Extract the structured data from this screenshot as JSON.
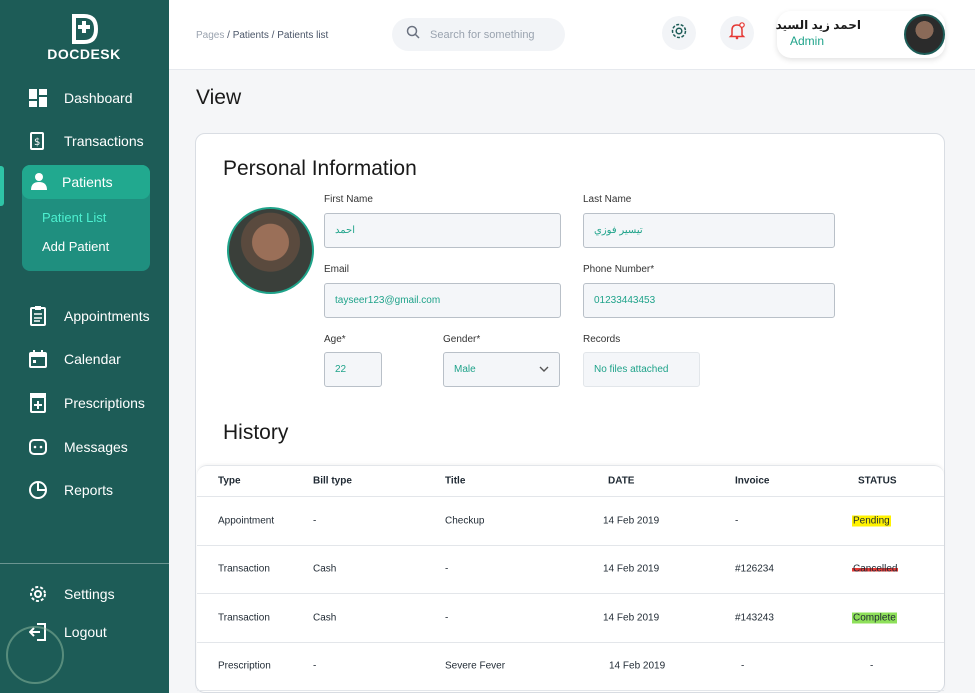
{
  "brand": {
    "name": "DOCDESK"
  },
  "sidebar": {
    "items": [
      {
        "label": "Dashboard",
        "icon": "dashboard-icon"
      },
      {
        "label": "Transactions",
        "icon": "transactions-icon"
      },
      {
        "label": "Patients",
        "icon": "user-icon",
        "active": true
      },
      {
        "label": "Appointments",
        "icon": "clipboard-icon"
      },
      {
        "label": "Calendar",
        "icon": "calendar-icon"
      },
      {
        "label": "Prescriptions",
        "icon": "prescription-icon"
      },
      {
        "label": "Messages",
        "icon": "chat-icon"
      },
      {
        "label": "Reports",
        "icon": "pie-chart-icon"
      }
    ],
    "sub_items": [
      {
        "label": "Patient List",
        "active": true
      },
      {
        "label": "Add Patient"
      }
    ],
    "bottom": [
      {
        "label": "Settings",
        "icon": "gear-icon"
      },
      {
        "label": "Logout",
        "icon": "logout-icon"
      }
    ]
  },
  "header": {
    "breadcrumb": {
      "root": "Pages",
      "sep": "/",
      "section": "Patients",
      "current": "Patients list"
    },
    "search_placeholder": "Search for something",
    "user": {
      "name": "احمد زيد السيد",
      "role": "Admin"
    }
  },
  "page": {
    "title": "View"
  },
  "personal": {
    "title": "Personal Information",
    "first_name": {
      "label": "First Name",
      "value": "احمد"
    },
    "last_name": {
      "label": "Last Name",
      "value": "تيسير فوزي"
    },
    "email": {
      "label": "Email",
      "value": "tayseer123@gmail.com"
    },
    "phone": {
      "label": "Phone Number*",
      "value": "01233443453"
    },
    "age": {
      "label": "Age*",
      "value": "22"
    },
    "gender": {
      "label": "Gender*",
      "value": "Male"
    },
    "records": {
      "label": "Records",
      "value": "No files attached"
    }
  },
  "history": {
    "title": "History",
    "columns": [
      "Type",
      "Bill type",
      "Title",
      "DATE",
      "Invoice",
      "STATUS"
    ],
    "rows": [
      [
        "Appointment",
        "-",
        "Checkup",
        "14 Feb 2019",
        "-",
        "Pending"
      ],
      [
        "Transaction",
        "Cash",
        "-",
        "14 Feb 2019",
        "#126234",
        "Cancelled"
      ],
      [
        "Transaction",
        "Cash",
        "-",
        "14 Feb 2019",
        "#143243",
        "Complete"
      ],
      [
        "Prescription",
        "-",
        "Severe Fever",
        "14 Feb 2019",
        "-",
        "-"
      ]
    ]
  },
  "colors": {
    "sidebar_bg": "#1d5c57",
    "accent": "#1fa38a",
    "pending": "#fff200",
    "cancelled": "#e53935",
    "complete": "#8ee05a"
  }
}
